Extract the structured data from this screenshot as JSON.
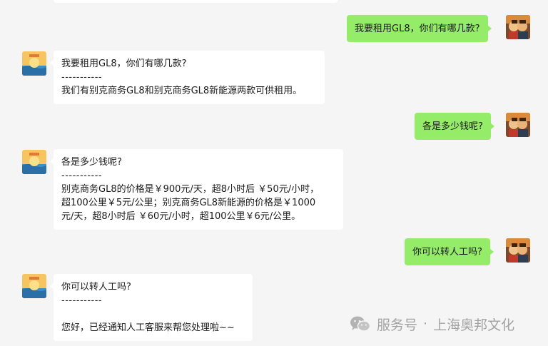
{
  "conversation": {
    "messages": [
      {
        "side": "out",
        "text": "我要租用GL8，你们有哪几款?"
      },
      {
        "side": "in",
        "quote": "我要租用GL8，你们有哪几款?",
        "divider": "-----------",
        "reply": [
          "我们有别克商务GL8和别克商务GL8新能源两款可供租用。"
        ]
      },
      {
        "side": "out",
        "text": "各是多少钱呢?"
      },
      {
        "side": "in",
        "quote": "各是多少钱呢?",
        "divider": "-----------",
        "reply": [
          "别克商务GL8的价格是￥900元/天，超8小时后 ￥50元/小时，",
          "超100公里￥5元/公里；别克商务GL8新能源的价格是￥1000",
          "元/天，超8小时后 ￥60元/小时，超100公里￥6元/公里。"
        ]
      },
      {
        "side": "out",
        "text": "你可以转人工吗?"
      },
      {
        "side": "in",
        "quote": "你可以转人工吗?",
        "divider": "-----------",
        "reply": [
          "",
          "您好，已经通知人工客服来帮您处理啦~~"
        ]
      }
    ]
  },
  "watermark": {
    "icon": "wechat-icon",
    "label": "服务号",
    "separator": "·",
    "account": "上海奥邦文化"
  },
  "colors": {
    "background": "#f5f5f5",
    "outgoing_bubble": "#95ec69",
    "incoming_bubble": "#ffffff",
    "watermark": "#a3a3a3"
  }
}
